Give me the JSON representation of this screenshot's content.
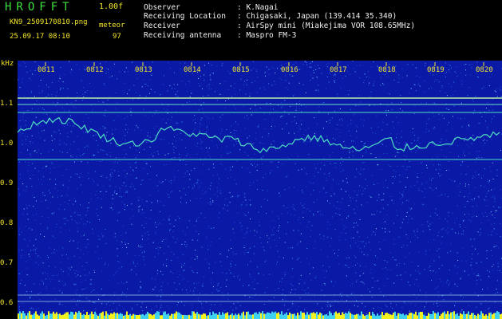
{
  "header": {
    "title": "HROFFT",
    "version": "1.00f",
    "filename": "KN9_2509170810.png",
    "meteors_label": "meteor",
    "meteors_count": "97",
    "datetime": "25.09.17 08:10"
  },
  "info": [
    {
      "label": "Observer",
      "value": ": K.Nagai"
    },
    {
      "label": "Receiving Location",
      "value": ": Chigasaki, Japan (139.414 35.340)"
    },
    {
      "label": "Receiver",
      "value": ": AirSpy mini (Miakejima VOR 108.65MHz)"
    },
    {
      "label": "Receiving antenna",
      "value": ": Maspro FM-3"
    }
  ],
  "axis": {
    "y_unit": "kHz",
    "y_ticks": [
      "1.1",
      "1.0",
      "0.9",
      "0.8",
      "0.7",
      "0.6"
    ],
    "x_ticks": [
      "0811",
      "0812",
      "0813",
      "0814",
      "0815",
      "0816",
      "0817",
      "0818",
      "0819",
      "0820"
    ]
  },
  "colors": {
    "background": "#0a1aa6",
    "noise": "#3fa0ff",
    "signal": "#4de0c0",
    "label": "#f2e62a"
  }
}
